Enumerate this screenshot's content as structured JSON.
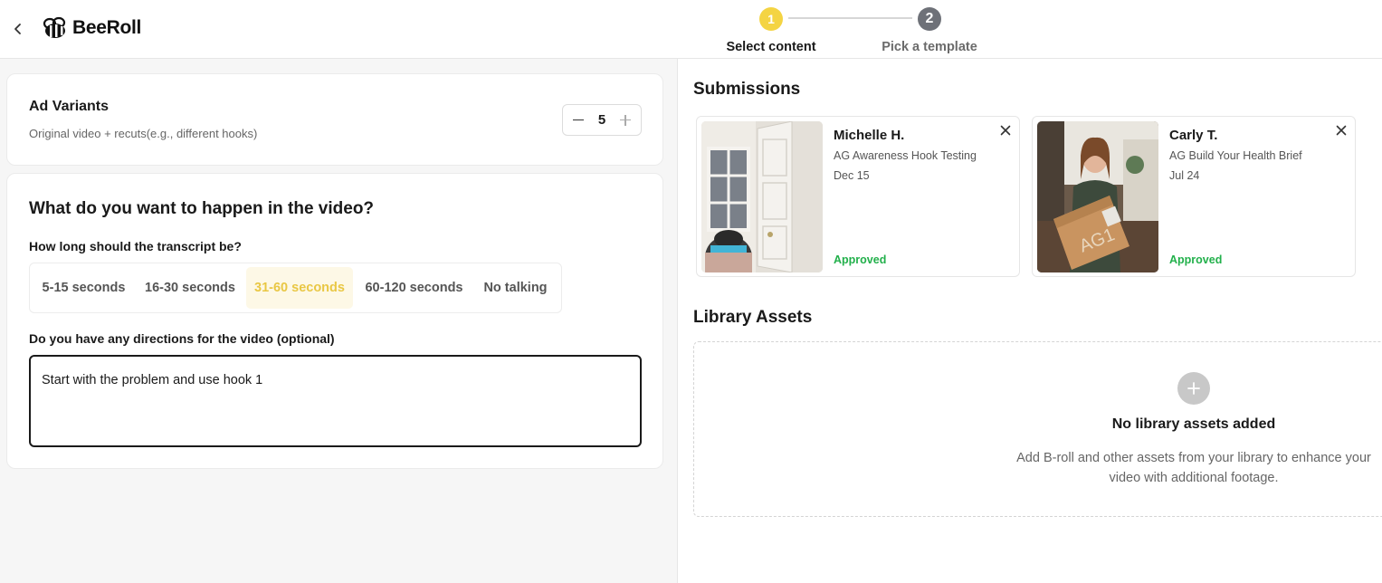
{
  "header": {
    "logo_text": "BeeRoll",
    "steps": [
      {
        "number": "1",
        "label": "Select content",
        "active": true
      },
      {
        "number": "2",
        "label": "Pick a template",
        "active": false
      }
    ]
  },
  "ad_variants": {
    "title": "Ad Variants",
    "subtitle": "Original video + recuts(e.g., different hooks)",
    "value": "5"
  },
  "video_form": {
    "title": "What do you want to happen in the video?",
    "transcript_question": "How long should the transcript be?",
    "length_options": [
      {
        "label": "5-15 seconds",
        "selected": false
      },
      {
        "label": "16-30 seconds",
        "selected": false
      },
      {
        "label": "31-60 seconds",
        "selected": true
      },
      {
        "label": "60-120 seconds",
        "selected": false
      },
      {
        "label": "No talking",
        "selected": false
      }
    ],
    "directions_question": "Do you have any directions for the video (optional)",
    "directions_value": "Start with the problem and use hook 1"
  },
  "submissions": {
    "title": "Submissions",
    "items": [
      {
        "name": "Michelle H.",
        "campaign": "AG Awareness Hook Testing",
        "date": "Dec 15",
        "status": "Approved"
      },
      {
        "name": "Carly T.",
        "campaign": "AG Build Your Health Brief",
        "date": "Jul 24",
        "status": "Approved"
      }
    ]
  },
  "library": {
    "title": "Library Assets",
    "empty_title": "No library assets added",
    "empty_description": "Add B-roll and other assets from your library to enhance your video with additional footage."
  },
  "colors": {
    "accent_yellow": "#f4d443",
    "approved_green": "#22b04b",
    "step_inactive": "#6e7178"
  },
  "icons": [
    "chevron-left-icon",
    "bee-logo-icon",
    "minus-icon",
    "plus-icon",
    "close-icon",
    "plus-circle-icon"
  ]
}
